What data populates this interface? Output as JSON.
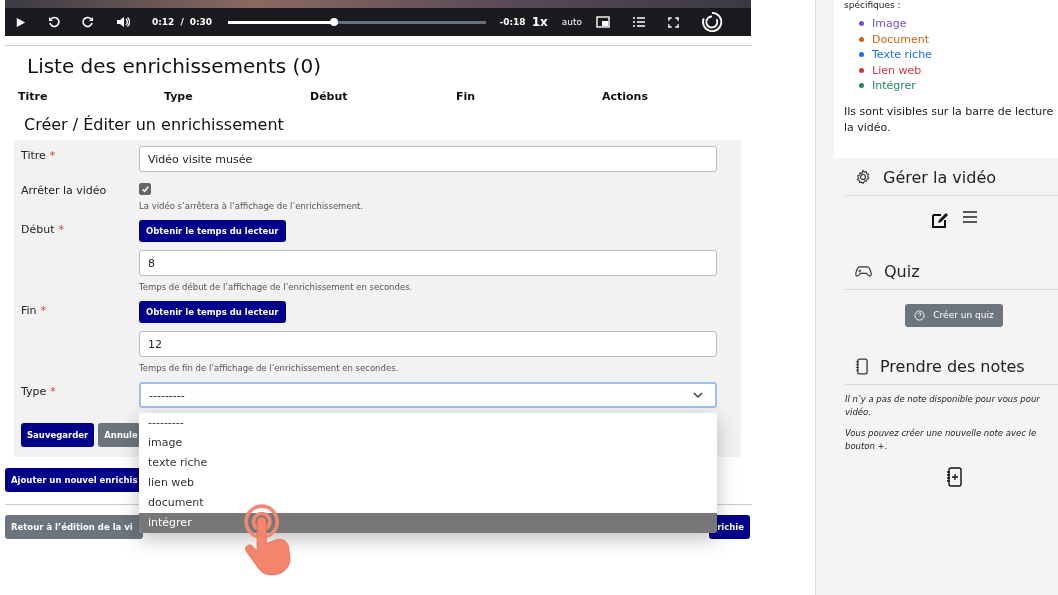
{
  "player": {
    "current_time": "0:12",
    "separator": "/",
    "duration": "0:30",
    "level": 0.41,
    "remaining": "-0:18",
    "speed": "1x",
    "quality": "auto"
  },
  "enrichments": {
    "title": "Liste des enrichissements (0)",
    "columns": [
      "Titre",
      "Type",
      "Début",
      "Fin",
      "Actions"
    ]
  },
  "form": {
    "title": "Créer / Éditer un enrichissement",
    "fields": [
      {
        "kind": "text",
        "label": "Titre",
        "required_mark": "*",
        "value": "Vidéo visite musée"
      },
      {
        "kind": "checkbox",
        "label": "Arrêter la vidéo",
        "checked": true,
        "help": "La vidéo s’arrêtera à l’affichage de l’enrichissement."
      },
      {
        "kind": "time",
        "label": "Début",
        "required_mark": "*",
        "button": "Obtenir le temps du lecteur",
        "value": "8",
        "help": "Temps de début de l’affichage de l’enrichissement en secondes."
      },
      {
        "kind": "time",
        "label": "Fin",
        "required_mark": "*",
        "button": "Obtenir le temps du lecteur",
        "value": "12",
        "help": "Temps de fin de l’affichage de l’enrichissement en secondes."
      },
      {
        "kind": "select",
        "label": "Type",
        "required_mark": "*",
        "value": "---------",
        "expanded": true,
        "options": [
          {
            "label": "---------",
            "highlighted": false
          },
          {
            "label": "image",
            "highlighted": false
          },
          {
            "label": "texte riche",
            "highlighted": false
          },
          {
            "label": "lien web",
            "highlighted": false
          },
          {
            "label": "document",
            "highlighted": false
          },
          {
            "label": "intégrer",
            "highlighted": true
          }
        ]
      }
    ],
    "save": "Sauvegarder",
    "cancel": "Annule"
  },
  "add_button": "Ajouter un nouvel enrichis",
  "back_button": "Retour à l’édition de la vi",
  "right_button": "richie",
  "sidebar": {
    "intro": "spécifiques :",
    "types": [
      {
        "label": "Image",
        "color": "#7b4fc4"
      },
      {
        "label": "Document",
        "color": "#c8650f"
      },
      {
        "label": "Texte riche",
        "color": "#1a6ef5"
      },
      {
        "label": "Lien web",
        "color": "#d03545"
      },
      {
        "label": "Intégrer",
        "color": "#1f8a5a"
      }
    ],
    "note": [
      "Ils sont visibles sur la barre de lecture",
      "la vidéo."
    ],
    "manage_title": "Gérer la vidéo",
    "quiz_title": "Quiz",
    "quiz_button": "Créer un quiz",
    "notes_title": "Prendre des notes",
    "notes_text": [
      [
        "Il n’y a pas de note disponible pour vous pour",
        "vidéo."
      ],
      [
        "Vous pouvez créer une nouvelle note avec le",
        "bouton +."
      ]
    ]
  }
}
